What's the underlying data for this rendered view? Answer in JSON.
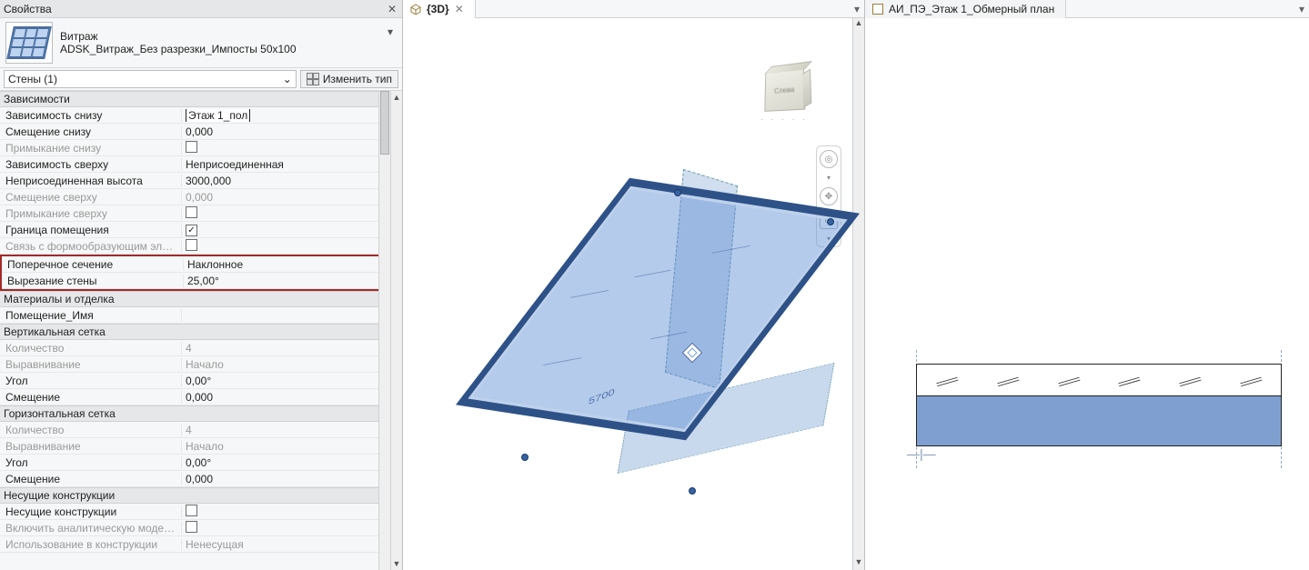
{
  "panels": {
    "properties": {
      "title": "Свойства",
      "family": "Витраж",
      "type_name": "ADSK_Витраж_Без разрезки_Импосты 50x100",
      "filter_label": "Стены (1)",
      "edit_type_label": "Изменить тип",
      "groups": [
        {
          "name": "Зависимости",
          "rows": [
            {
              "label": "Зависимость снизу",
              "value": "Этаж 1_пол",
              "inputLike": true
            },
            {
              "label": "Смещение снизу",
              "value": "0,000"
            },
            {
              "label": "Примыкание снизу",
              "value": "",
              "checkbox": true,
              "checked": false,
              "disabled": true
            },
            {
              "label": "Зависимость сверху",
              "value": "Неприсоединенная"
            },
            {
              "label": "Неприсоединенная высота",
              "value": "3000,000"
            },
            {
              "label": "Смещение сверху",
              "value": "0,000",
              "disabled": true
            },
            {
              "label": "Примыкание сверху",
              "value": "",
              "checkbox": true,
              "checked": false,
              "disabled": true
            },
            {
              "label": "Граница помещения",
              "value": "",
              "checkbox": true,
              "checked": true
            },
            {
              "label": "Связь с формообразующим эл…",
              "value": "",
              "checkbox": true,
              "checked": false,
              "disabled": true
            }
          ],
          "highlighted_rows": [
            {
              "label": "Поперечное сечение",
              "value": "Наклонное"
            },
            {
              "label": "Вырезание стены",
              "value": "25,00°"
            }
          ]
        },
        {
          "name": "Материалы и отделка",
          "rows": [
            {
              "label": "Помещение_Имя",
              "value": ""
            }
          ]
        },
        {
          "name": "Вертикальная сетка",
          "rows": [
            {
              "label": "Количество",
              "value": "4",
              "disabled": true
            },
            {
              "label": "Выравнивание",
              "value": "Начало",
              "disabled": true
            },
            {
              "label": "Угол",
              "value": "0,00°"
            },
            {
              "label": "Смещение",
              "value": "0,000"
            }
          ]
        },
        {
          "name": "Горизонтальная сетка",
          "rows": [
            {
              "label": "Количество",
              "value": "4",
              "disabled": true
            },
            {
              "label": "Выравнивание",
              "value": "Начало",
              "disabled": true
            },
            {
              "label": "Угол",
              "value": "0,00°"
            },
            {
              "label": "Смещение",
              "value": "0,000"
            }
          ]
        },
        {
          "name": "Несущие конструкции",
          "rows": [
            {
              "label": "Несущие конструкции",
              "value": "",
              "checkbox": true,
              "checked": false
            },
            {
              "label": "Включить аналитическую моде…",
              "value": "",
              "checkbox": true,
              "checked": false,
              "disabled": true
            },
            {
              "label": "Использование в конструкции",
              "value": "Ненесущая",
              "disabled": true
            }
          ]
        }
      ]
    }
  },
  "views": {
    "view3d": {
      "tab_label": "{3D}",
      "viewcube_face": "Слева",
      "dimension_text": "5700"
    },
    "plan": {
      "tab_label": "АИ_ПЭ_Этаж 1_Обмерный план"
    }
  }
}
